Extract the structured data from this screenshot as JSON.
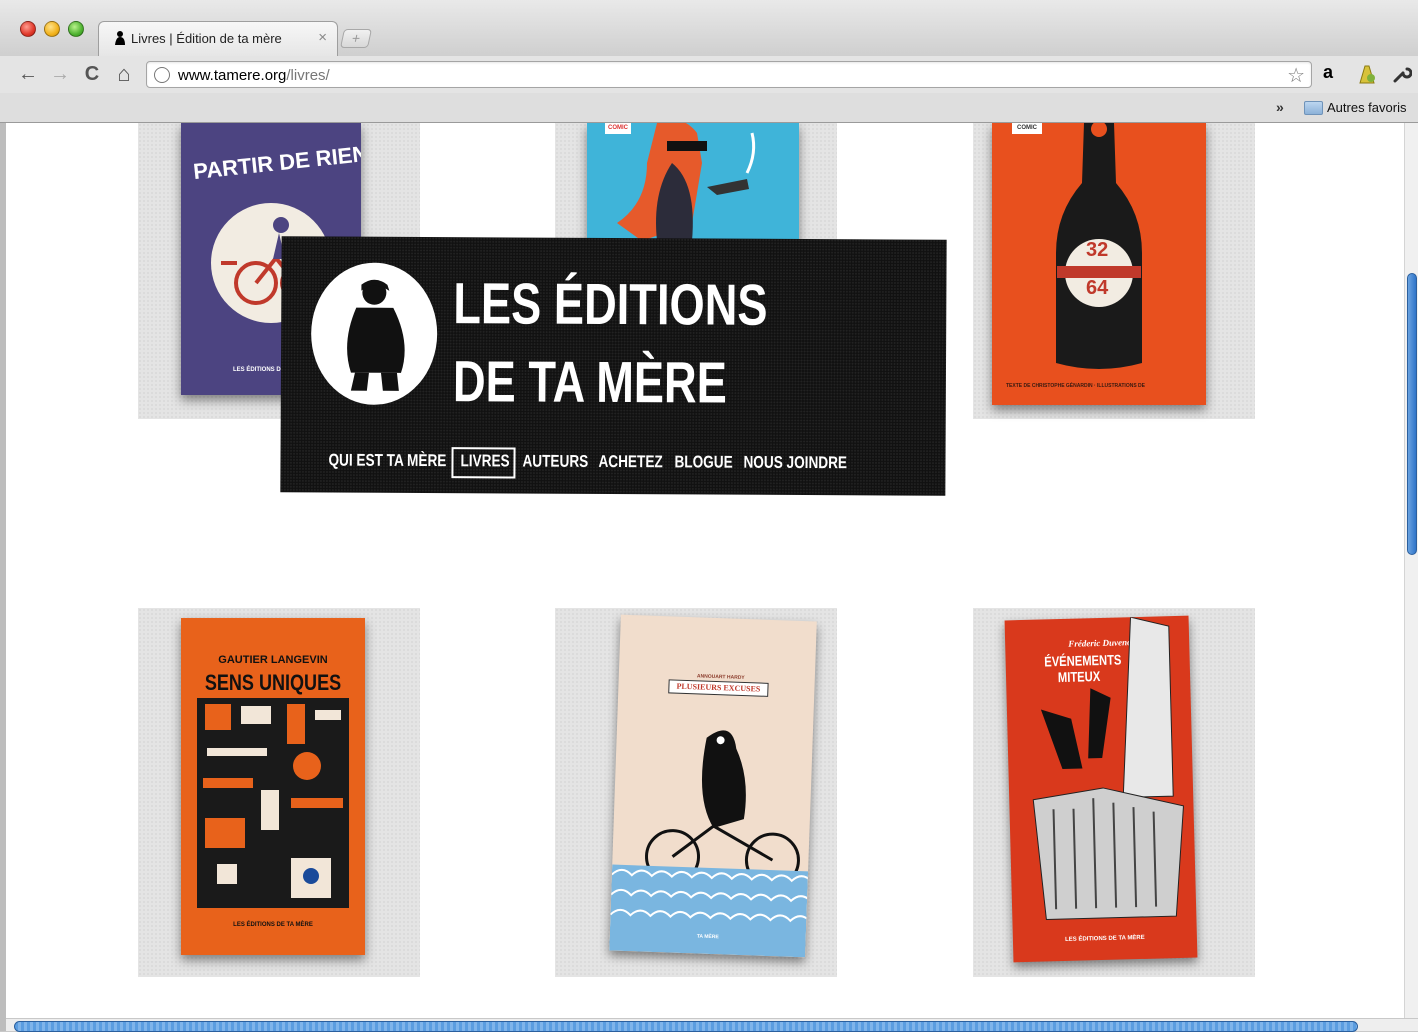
{
  "browser": {
    "tab_title": "Livres | Édition de ta mère",
    "tab_close": "×",
    "new_tab": "+",
    "url_host": "www.tamere.org",
    "url_path": "/livres/",
    "back": "←",
    "forward": "→",
    "reload": "C",
    "home": "⌂",
    "star": "☆",
    "ext_amazon": "a",
    "wrench": "🔧",
    "bookmarks_chevron": "»",
    "bookmark_folder": "Autres favoris"
  },
  "site": {
    "brand_line1": "LES ÉDITIONS",
    "brand_line2": "DE TA MÈRE",
    "nav": [
      "QUI EST TA MÈRE",
      "LIVRES",
      "AUTEURS",
      "ACHETEZ",
      "BLOGUE",
      "NOUS JOINDRE"
    ],
    "active_nav": "LIVRES"
  },
  "books": [
    {
      "title": "PARTIR DE RIEN",
      "publisher": "LES ÉDITIONS D",
      "color": "#4c4481"
    },
    {
      "title": "",
      "tag": "COMIC",
      "color": "#3fb4d9"
    },
    {
      "title": "",
      "tag": "COMIC",
      "numbers": [
        "32",
        "64"
      ],
      "credits": "TEXTE DE CHRISTOPHE GÉNARDIN · ILLUSTRATIONS DE",
      "color": "#e8501e"
    },
    {
      "author": "GAUTIER LANGEVIN",
      "title": "SENS UNIQUES",
      "publisher": "LES ÉDITIONS DE TA MÈRE",
      "color": "#e8621b"
    },
    {
      "author": "ANNOUART HARDY",
      "title": "PLUSIEURS EXCUSES",
      "publisher": "TA MÈRE",
      "color": "#f1ddcc"
    },
    {
      "author": "Fréderic Duvenot",
      "title": "ÉVÉNEMENTS MITEUX",
      "publisher": "LES ÉDITIONS DE TA MÈRE",
      "color": "#d9391c"
    }
  ],
  "colors": {
    "banner": "#111111",
    "scroll_accent": "#2f74c9"
  }
}
